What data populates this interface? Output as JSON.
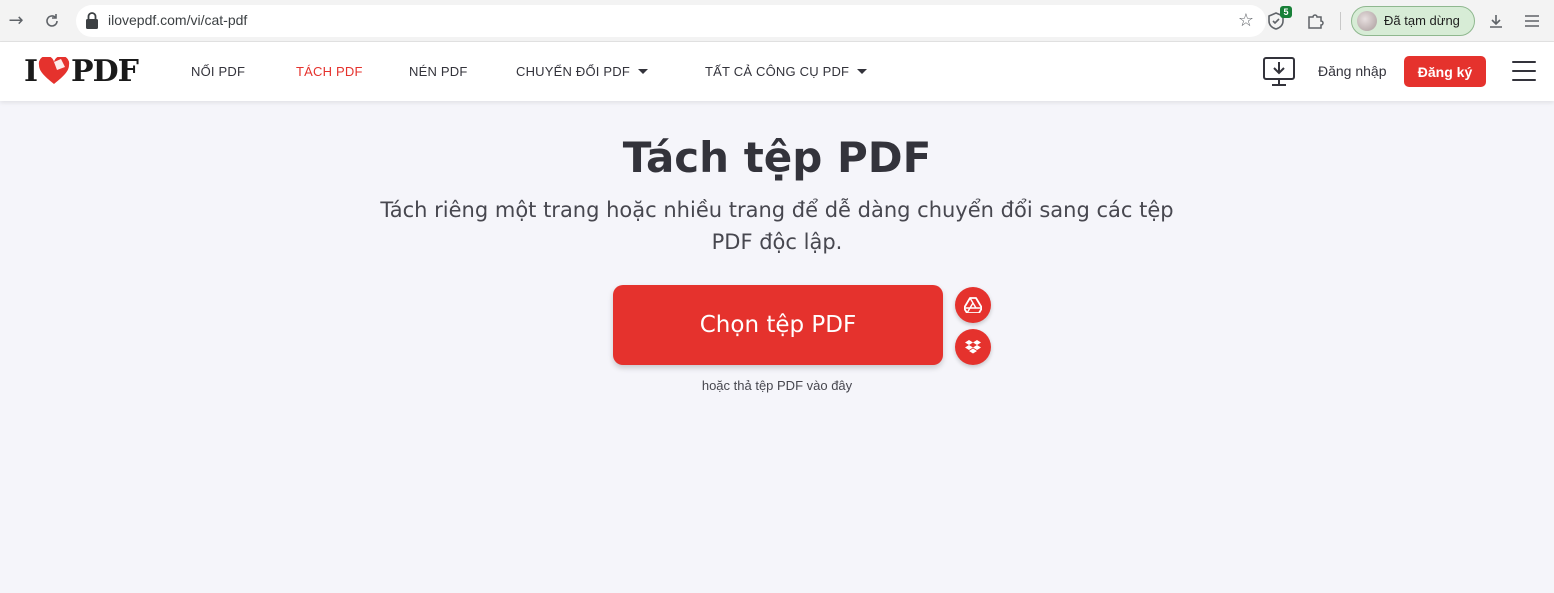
{
  "browser": {
    "url": "ilovepdf.com/vi/cat-pdf",
    "profile_label": "Đã tạm dừng",
    "extension_badge": "5"
  },
  "header": {
    "logo_left": "I",
    "logo_right": "PDF",
    "nav": [
      {
        "label": "NỐI PDF"
      },
      {
        "label": "TÁCH PDF"
      },
      {
        "label": "NÉN PDF"
      },
      {
        "label": "CHUYỂN ĐỔI PDF"
      },
      {
        "label": "TẤT CẢ CÔNG CỤ PDF"
      }
    ],
    "login_label": "Đăng nhập",
    "signup_label": "Đăng ký"
  },
  "main": {
    "title": "Tách tệp PDF",
    "subtitle": "Tách riêng một trang hoặc nhiều trang để dễ dàng chuyển đổi sang các tệp PDF độc lập.",
    "select_button": "Chọn tệp PDF",
    "drop_hint": "hoặc thả tệp PDF vào đây"
  },
  "colors": {
    "brand": "#e5322d",
    "background": "#f5f5fa"
  },
  "icons": {
    "google_drive": "google-drive-icon",
    "dropbox": "dropbox-icon",
    "desktop_download": "desktop-download-icon"
  }
}
